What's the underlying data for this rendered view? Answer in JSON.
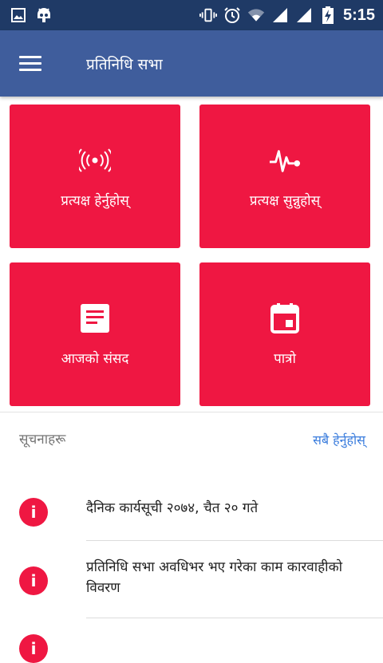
{
  "status_bar": {
    "time": "5:15",
    "left_icons": [
      "image-icon",
      "android-icon"
    ],
    "right_icons": [
      "vibrate-icon",
      "alarm-icon",
      "wifi-icon",
      "signal-icon",
      "signal-icon",
      "battery-charging-icon"
    ]
  },
  "app_bar": {
    "title": "प्रतिनिधि सभा",
    "menu_icon": "hamburger-menu-icon",
    "background": "#3f5d9c"
  },
  "tiles": [
    {
      "label": "प्रत्यक्ष हेर्नुहोस्",
      "icon": "live-broadcast-icon"
    },
    {
      "label": "प्रत्यक्ष सुन्नुहोस्",
      "icon": "pulse-icon"
    },
    {
      "label": "आजको संसद",
      "icon": "document-icon"
    },
    {
      "label": "पात्रो",
      "icon": "calendar-icon"
    }
  ],
  "tile_color": "#ef1742",
  "notices": {
    "heading": "सूचनाहरू",
    "see_all": "सबै हेर्नुहोस्",
    "icon": "info-icon",
    "items": [
      {
        "text": "दैनिक कार्यसूची २०७४, चैत २० गते"
      },
      {
        "text": "प्रतिनिधि सभा अवधिभर भए गरेका काम कारवाहीको विवरण"
      }
    ]
  }
}
